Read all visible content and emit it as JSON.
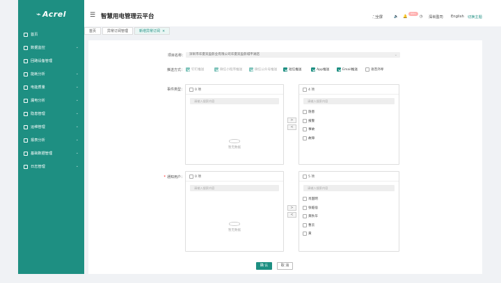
{
  "sidebar": {
    "logo": "Acrel",
    "items": [
      {
        "icon": "home-icon",
        "label": "首页",
        "arrow": false
      },
      {
        "icon": "monitor-icon",
        "label": "数据监控",
        "arrow": true
      },
      {
        "icon": "device-icon",
        "label": "回路设备管理",
        "arrow": false
      },
      {
        "icon": "energy-icon",
        "label": "能耗分析",
        "arrow": true
      },
      {
        "icon": "power-quality-icon",
        "label": "电能质量",
        "arrow": true
      },
      {
        "icon": "safety-icon",
        "label": "漏电分析",
        "arrow": true
      },
      {
        "icon": "alarm-icon",
        "label": "隐患管理",
        "arrow": true
      },
      {
        "icon": "maintenance-icon",
        "label": "运维管理",
        "arrow": true
      },
      {
        "icon": "report-icon",
        "label": "报表分析",
        "arrow": true
      },
      {
        "icon": "settings-icon",
        "label": "基础数据管理",
        "arrow": true
      },
      {
        "icon": "log-icon",
        "label": "日志管理",
        "arrow": true
      }
    ]
  },
  "header": {
    "title": "智慧用电管理云平台",
    "fullscreen": "全屏",
    "badge": "99+",
    "user": "深圳盈司",
    "lang": "English",
    "theme": "切换主题"
  },
  "tabs": [
    {
      "label": "首页",
      "active": false
    },
    {
      "label": "异常订阅管理",
      "active": false
    },
    {
      "label": "新增异常订阅",
      "active": true,
      "close": "×"
    }
  ],
  "form": {
    "project_label": "项目名称：",
    "project_value": "深圳市华夏双盈影业有限公司华夏双盈影城平湖店",
    "push_label": "推送方式：",
    "push_options": [
      {
        "label": "钉钉推送",
        "state": "disabled-on"
      },
      {
        "label": "微信小程序推送",
        "state": "disabled-on"
      },
      {
        "label": "微信公众号推送",
        "state": "disabled-on"
      },
      {
        "label": "短信推送",
        "state": "on"
      },
      {
        "label": "App推送",
        "state": "on"
      },
      {
        "label": "Email推送",
        "state": "on"
      },
      {
        "label": "语音外呼",
        "state": "off"
      }
    ],
    "event_label": "事件类型：",
    "notify_label": "通知用户："
  },
  "event_transfer": {
    "left": {
      "count": "0 项",
      "placeholder": "请输入搜索内容",
      "empty": "暂无数据"
    },
    "right": {
      "count": "4 项",
      "placeholder": "请输入搜索内容",
      "items": [
        "隐患",
        "报警",
        "事故",
        "故障"
      ]
    },
    "to_right": ">",
    "to_left": "<"
  },
  "user_transfer": {
    "left": {
      "count": "0 项",
      "placeholder": "请输入搜索内容",
      "empty": "暂无数据"
    },
    "right": {
      "count": "5 项",
      "placeholder": "请输入搜索内容",
      "items": [
        "肖国明",
        "张临宿",
        "黄秋华",
        "曹云",
        "黄"
      ]
    },
    "to_right": ">",
    "to_left": "<"
  },
  "actions": {
    "confirm": "确 认",
    "cancel": "取 消"
  },
  "colors": {
    "accent": "#1e8f82"
  }
}
